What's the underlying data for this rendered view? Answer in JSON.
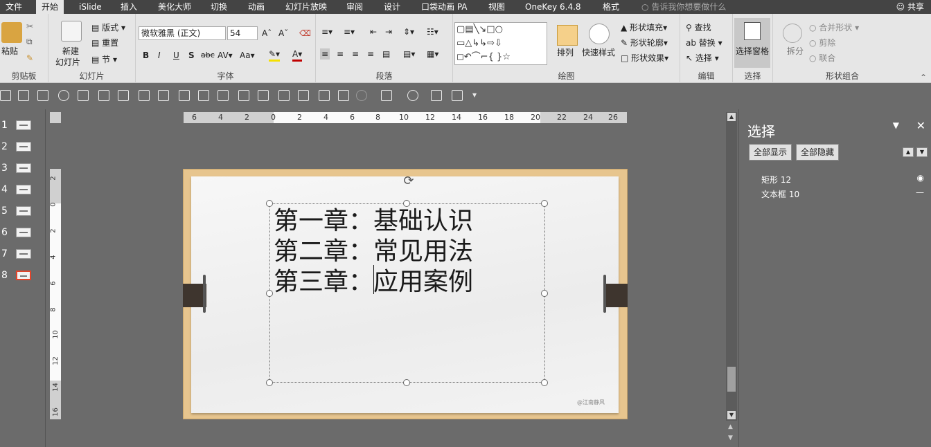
{
  "tabs": [
    "文件",
    "开始",
    "iSlide",
    "插入",
    "美化大师",
    "切换",
    "动画",
    "幻灯片放映",
    "审阅",
    "设计",
    "口袋动画 PA",
    "视图",
    "OneKey 6.4.8",
    "格式"
  ],
  "active_tab": "开始",
  "tell_me": "告诉我你想要做什么",
  "share": "共享",
  "ribbon": {
    "clipboard": {
      "paste": "粘贴",
      "label": "剪贴板"
    },
    "slides": {
      "new_slide": "新建\n幻灯片",
      "new_slide_l1": "新建",
      "new_slide_l2": "幻灯片",
      "layout": "版式",
      "reset": "重置",
      "section": "节",
      "label": "幻灯片"
    },
    "font": {
      "name": "微软雅黑 (正文)",
      "size": "54",
      "label": "字体",
      "bold": "B",
      "italic": "I",
      "underline": "U",
      "shadow": "S",
      "strike": "abc"
    },
    "paragraph": {
      "label": "段落"
    },
    "drawing": {
      "arrange": "排列",
      "quick_styles": "快速样式",
      "fill": "形状填充",
      "outline": "形状轮廓",
      "effects": "形状效果",
      "label": "绘图"
    },
    "editing": {
      "find": "查找",
      "replace": "替换",
      "select": "选择",
      "label": "编辑"
    },
    "selection": {
      "pane": "选择窗格",
      "label": "选择"
    },
    "shape_combine": {
      "split": "拆分",
      "merge": "合并形状",
      "subtract": "剪除",
      "union": "联合",
      "label": "形状组合"
    }
  },
  "slides": [
    "1",
    "2",
    "3",
    "4",
    "5",
    "6",
    "7",
    "8"
  ],
  "selected_slide": "8",
  "ruler_h": [
    "6",
    "4",
    "2",
    "0",
    "2",
    "4",
    "6",
    "8",
    "10",
    "12",
    "14",
    "16",
    "18",
    "20",
    "22",
    "24",
    "26"
  ],
  "ruler_v": [
    "2",
    "0",
    "2",
    "4",
    "6",
    "8",
    "10",
    "12",
    "14",
    "16"
  ],
  "slide": {
    "lines": [
      "第一章：基础认识",
      "第二章：常见用法",
      "第三章：应用案例"
    ],
    "watermark": "@江南静风"
  },
  "pane": {
    "title": "选择",
    "show_all": "全部显示",
    "hide_all": "全部隐藏",
    "objects": [
      {
        "name": "矩形 12",
        "visible": true
      },
      {
        "name": "文本框 10",
        "visible": false
      }
    ]
  }
}
